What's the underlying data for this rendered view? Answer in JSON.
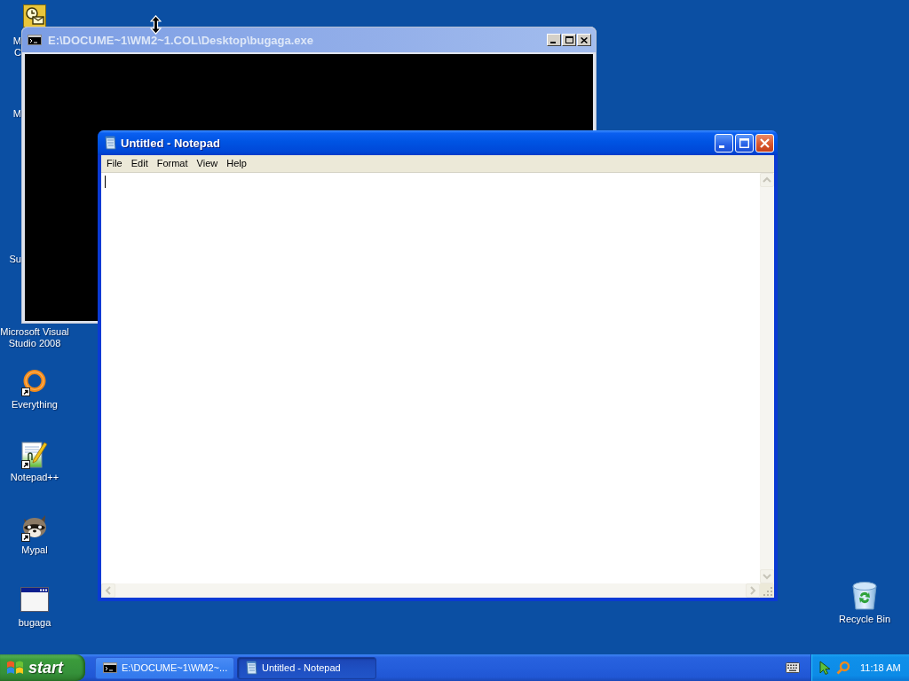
{
  "desktop": {
    "icons": [
      {
        "kind": "clock",
        "lines": [
          "M",
          "C"
        ],
        "shortcut": false,
        "covered": true
      },
      {
        "kind": "none",
        "lines": [
          "M"
        ],
        "shortcut": false,
        "covered": true
      },
      {
        "kind": "none",
        "lines": [
          "Su"
        ],
        "shortcut": false,
        "covered": true
      },
      {
        "kind": "none",
        "lines": [
          "Microsoft Visual",
          "Studio 2008"
        ],
        "shortcut": false,
        "covered": false
      },
      {
        "kind": "ring",
        "lines": [
          "Everything"
        ],
        "shortcut": true,
        "covered": false
      },
      {
        "kind": "notepad-plus",
        "lines": [
          "Notepad++"
        ],
        "shortcut": true,
        "covered": false
      },
      {
        "kind": "raccoon",
        "lines": [
          "Mypal"
        ],
        "shortcut": true,
        "covered": false
      },
      {
        "kind": "window",
        "lines": [
          "bugaga"
        ],
        "shortcut": false,
        "covered": false
      }
    ],
    "right_icons": [
      {
        "kind": "recycle-bin",
        "lines": [
          "Recycle Bin"
        ],
        "shortcut": false,
        "covered": false
      }
    ]
  },
  "windows": [
    {
      "kind": "console",
      "title": "E:\\DOCUME~1\\WM2~1.COL\\Desktop\\bugaga.exe",
      "active": false
    },
    {
      "kind": "notepad",
      "title": "Untitled - Notepad",
      "active": true,
      "menu": [
        "File",
        "Edit",
        "Format",
        "View",
        "Help"
      ]
    }
  ],
  "taskbar": {
    "start": "start",
    "tasks": [
      {
        "kind": "console",
        "label": "E:\\DOCUME~1\\WM2~...",
        "selected": false
      },
      {
        "kind": "notepad",
        "label": "Untitled - Notepad",
        "selected": true
      }
    ],
    "clock": "11:18 AM"
  }
}
